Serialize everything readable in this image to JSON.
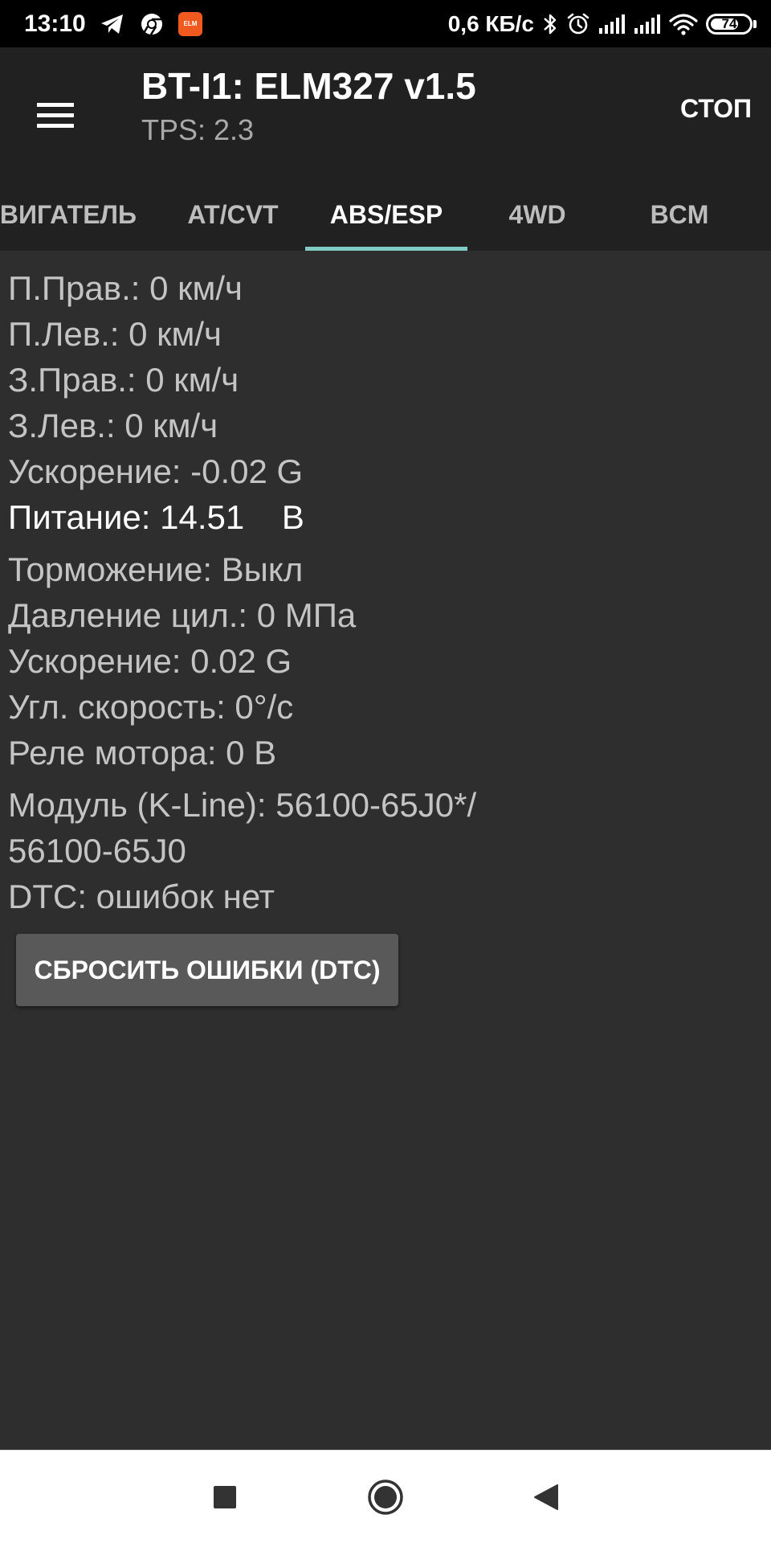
{
  "status_bar": {
    "time": "13:10",
    "net_speed": "0,6 КБ/с",
    "battery_level": "74",
    "battery_percent": 74,
    "icons": [
      "telegram-icon",
      "chrome-icon",
      "app-notification-icon",
      "bluetooth-icon",
      "alarm-icon",
      "signal-icon",
      "signal-icon",
      "wifi-icon",
      "battery-icon"
    ],
    "app_badge_text": "ELM"
  },
  "app_bar": {
    "title": "BT-I1: ELM327 v1.5",
    "subtitle": "TPS: 2.3",
    "action": "СТОП",
    "menu_icon": "hamburger-menu-icon"
  },
  "tabs": [
    {
      "label": "ДВИГАТЕЛЬ",
      "active": false
    },
    {
      "label": "AT/CVT",
      "active": false
    },
    {
      "label": "ABS/ESP",
      "active": true
    },
    {
      "label": "4WD",
      "active": false
    },
    {
      "label": "BCM",
      "active": false
    }
  ],
  "readings": {
    "front_right": "П.Прав.: 0 км/ч",
    "front_left": "П.Лев.: 0 км/ч",
    "rear_right": "З.Прав.: 0 км/ч",
    "rear_left": "З.Лев.: 0 км/ч",
    "acceleration_1": "Ускорение: -0.02 G",
    "power": "Питание: 14.51    В",
    "braking": "Торможение: Выкл",
    "cyl_pressure": "Давление цил.: 0 МПа",
    "acceleration_2": "Ускорение: 0.02 G",
    "angular_speed": "Угл. скорость: 0°/с",
    "motor_relay": "Реле мотора: 0 В",
    "module_line1": "Модуль (K-Line): 56100-65J0*/",
    "module_line2": "56100-65J0",
    "dtc": "DTC: ошибок нет"
  },
  "reset_button": "СБРОСИТЬ ОШИБКИ (DTC)",
  "nav_bar": {
    "icons": [
      "recents-square-icon",
      "home-circle-icon",
      "back-triangle-icon"
    ]
  },
  "colors": {
    "status_bar_bg": "#000000",
    "app_bar_bg": "#212121",
    "content_bg": "#2e2e2e",
    "tab_indicator": "#80cbc4",
    "text_primary": "#ffffff",
    "text_secondary": "#c4c4c4",
    "button_bg": "#595959",
    "nav_bar_bg": "#ffffff",
    "app_badge": "#f05a1e"
  }
}
